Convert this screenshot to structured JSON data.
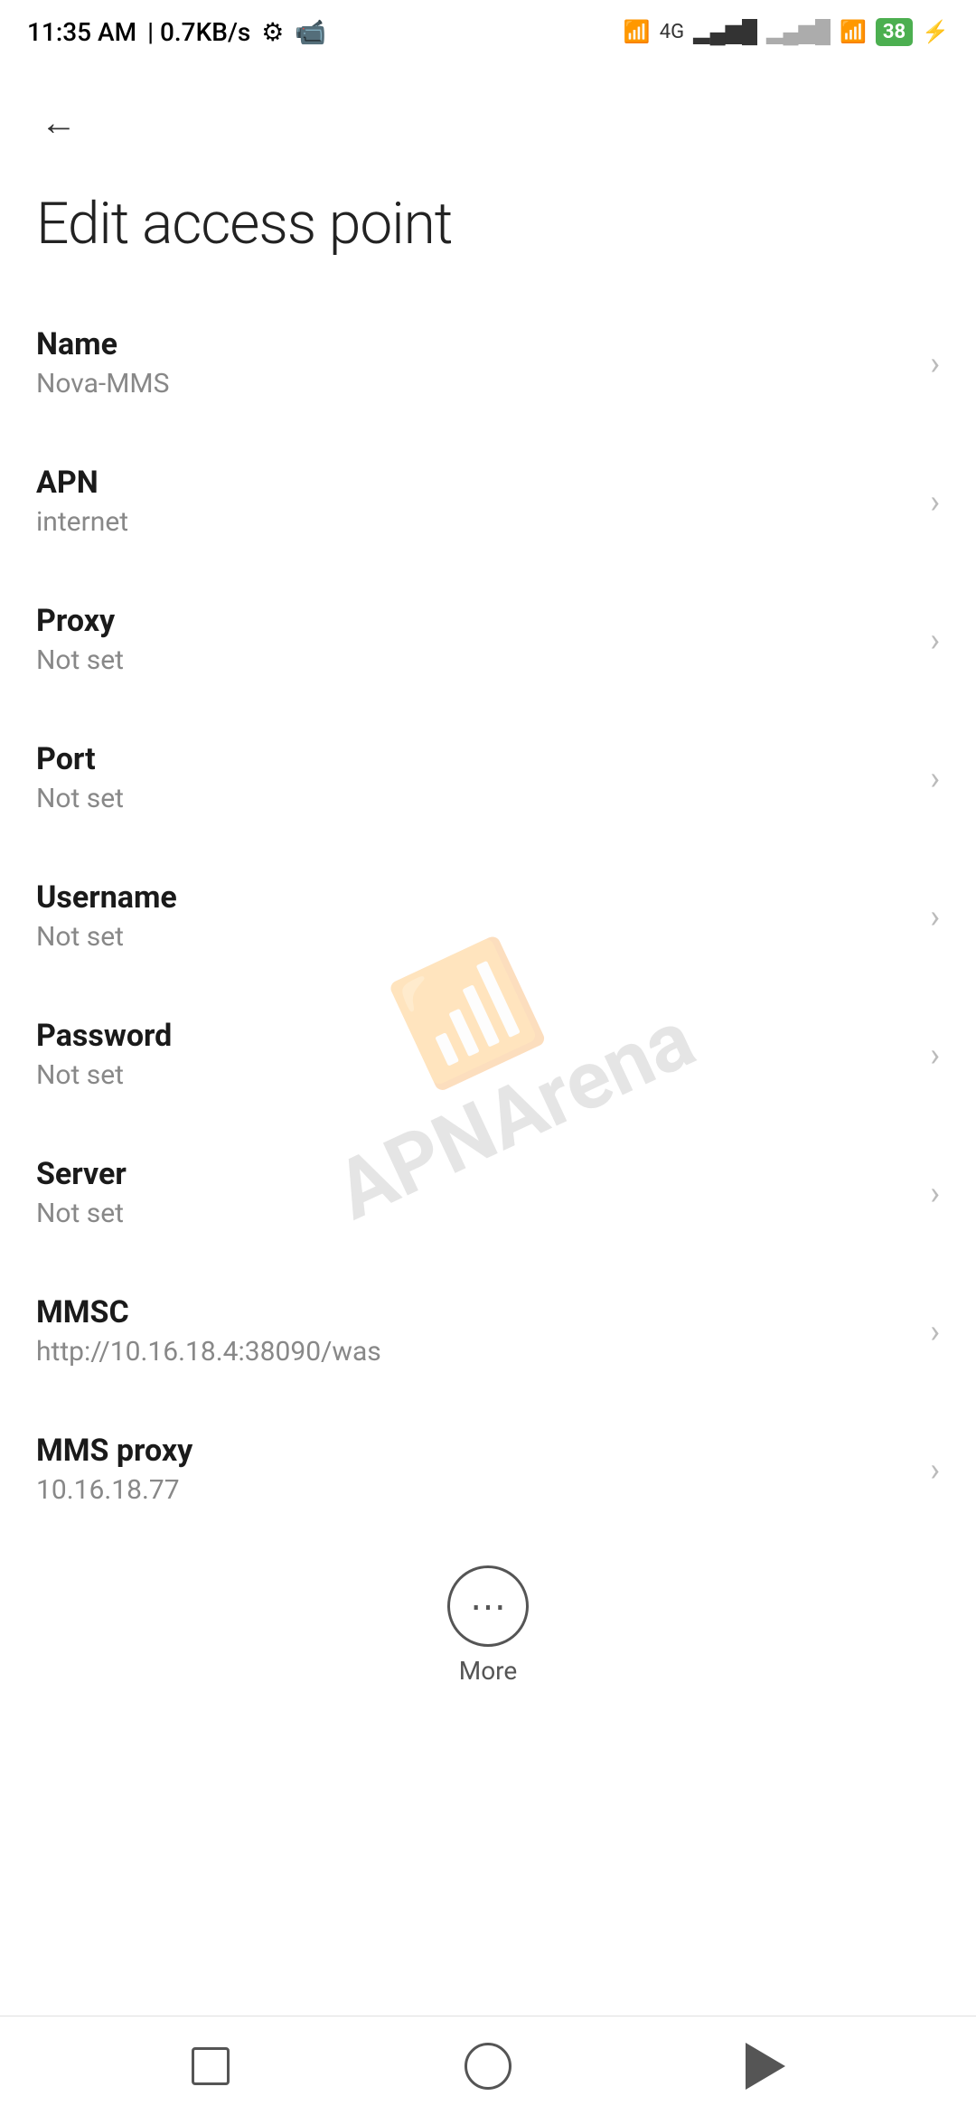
{
  "statusBar": {
    "time": "11:35 AM",
    "speed": "0.7KB/s"
  },
  "page": {
    "title": "Edit access point",
    "back_label": "Back"
  },
  "settings": [
    {
      "label": "Name",
      "value": "Nova-MMS"
    },
    {
      "label": "APN",
      "value": "internet"
    },
    {
      "label": "Proxy",
      "value": "Not set"
    },
    {
      "label": "Port",
      "value": "Not set"
    },
    {
      "label": "Username",
      "value": "Not set"
    },
    {
      "label": "Password",
      "value": "Not set"
    },
    {
      "label": "Server",
      "value": "Not set"
    },
    {
      "label": "MMSC",
      "value": "http://10.16.18.4:38090/was"
    },
    {
      "label": "MMS proxy",
      "value": "10.16.18.77"
    }
  ],
  "more": {
    "label": "More"
  },
  "bottomNav": {
    "square": "recent-apps",
    "circle": "home",
    "triangle": "back"
  }
}
